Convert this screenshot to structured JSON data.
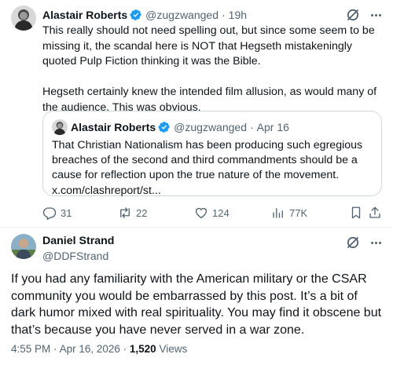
{
  "reply": {
    "author_name": "Alastair Roberts",
    "author_handle": "@zugzwanged",
    "separator": "·",
    "time": "19h",
    "paragraphs": [
      "This really should not need spelling out, but since some seem to be missing it, the scandal here is NOT that Hegseth mistakeningly quoted Pulp Fiction thinking it was the Bible.",
      "Hegseth certainly knew the intended film allusion, as would many of the audience. This was obvious."
    ],
    "quote": {
      "author_name": "Alastair Roberts",
      "author_handle": "@zugzwanged",
      "separator": "·",
      "date": "Apr 16",
      "text": "That Christian Nationalism has been producing such egregious breaches of the second and third commandments should be a cause for reflection upon the true nature of the movement.",
      "link": "x.com/clashreport/st..."
    },
    "actions": {
      "replies": "31",
      "reposts": "22",
      "likes": "124",
      "views": "77K"
    }
  },
  "main": {
    "author_name": "Daniel Strand",
    "author_handle": "@DDFStrand",
    "text": "If you had any familiarity with the American military or the CSAR community you would be embarrassed by this post. It’s a bit of dark humor mixed with real spirituality. You may find it obscene but that’s because you have never served in a war zone.",
    "time": "4:55 PM",
    "separator": "·",
    "date": "Apr 16, 2026",
    "views_count": "1,520",
    "views_label": "Views"
  },
  "colors": {
    "text": "#0f1419",
    "muted": "#536471",
    "verified": "#1d9bf0",
    "border": "#cfd9de"
  },
  "icons": [
    "verified-badge-icon",
    "grok-icon",
    "more-icon",
    "reply-icon",
    "repost-icon",
    "like-icon",
    "views-icon",
    "bookmark-icon",
    "share-icon"
  ]
}
